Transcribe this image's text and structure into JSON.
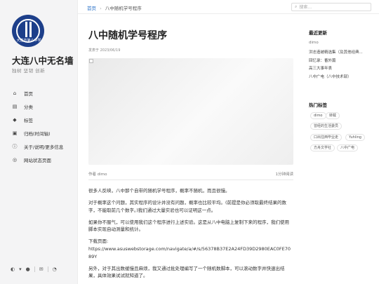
{
  "site": {
    "title": "大连八中无名墙",
    "subtitle": "独树 坚韧 创新",
    "avatar_text": "大连市第八中学",
    "nav": [
      {
        "icon": "home-icon",
        "glyph": "⌂",
        "label": "首页"
      },
      {
        "icon": "folder-icon",
        "glyph": "▤",
        "label": "分类"
      },
      {
        "icon": "tag-icon",
        "glyph": "◆",
        "label": "标签"
      },
      {
        "icon": "archive-icon",
        "glyph": "▣",
        "label": "归档(时间轴)"
      },
      {
        "icon": "info-icon",
        "glyph": "ⓘ",
        "label": "关于/说明/更多信息"
      },
      {
        "icon": "globe-icon",
        "glyph": "◎",
        "label": "网站状态页面"
      }
    ],
    "footer_icons": [
      "theme-toggle-icon",
      "github-icon",
      "email-icon",
      "rss-icon"
    ]
  },
  "topbar": {
    "breadcrumb_home": "首页",
    "breadcrumb_sep": "›",
    "breadcrumb_current": "八中随机学号程序",
    "search_placeholder": "搜索..."
  },
  "post": {
    "title": "八中随机学号程序",
    "published": "发表于 2023/06/19",
    "author": "作者 dimo",
    "read_time": "1分钟阅读",
    "paragraphs": [
      "很多人反映，八中那个自带的随机学号程序，概率不随机，而且很慢。",
      "对于概率这个问题，其实程序的设计并没有问题，概率也比较平均。(前提是你必须取最终结果的数字，不能取前几个数字。)我们通过大量实验也可以证明这一点。",
      "如果你不服气，可以使用我们这个程序进行上述实验。这是从八中电脑上复制下来的程序，我们使用脚本实现自动测量和统计。",
      "下载页面:",
      "另外，对于其出数缓慢且麻烦，我又通过批处理编写了一个随机数脚本，可以滚动数字并快速出结果，具体效果试试就知道了。"
    ],
    "download_url": "https://www.asuswebstorage.com/navigate/a/#/s/56378B37E2A24FD39D2980EAC0FE7089Y"
  },
  "sidebar_right": {
    "recent_title": "最近更新",
    "recent_items": [
      {
        "text": "dimo",
        "muted": true
      },
      {
        "text": "洪志造被精选集（及其他经典...",
        "muted": false
      },
      {
        "text": "回忆录：番外篇",
        "muted": false
      },
      {
        "text": "高三大事年表",
        "muted": false
      },
      {
        "text": "八中广电（八中技术部）",
        "muted": false
      }
    ],
    "tags_title": "热门标签",
    "tags": [
      "dimo",
      "转载",
      "曾经的生活委员",
      "口出往西毕业走",
      "Yuhling",
      "方舟文学社",
      "八中广电"
    ]
  }
}
